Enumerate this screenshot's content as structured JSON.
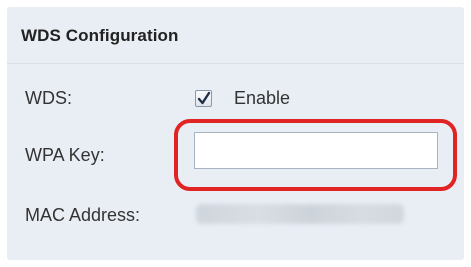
{
  "section": {
    "title": "WDS Configuration"
  },
  "wds": {
    "label": "WDS:",
    "checkbox_checked": true,
    "enable_label": "Enable"
  },
  "wpa_key": {
    "label": "WPA Key:",
    "value": "",
    "placeholder": ""
  },
  "mac_address": {
    "label": "MAC Address:",
    "value": ""
  },
  "colors": {
    "panel_background": "#e9eef5",
    "highlight_annotation": "#e02424"
  }
}
